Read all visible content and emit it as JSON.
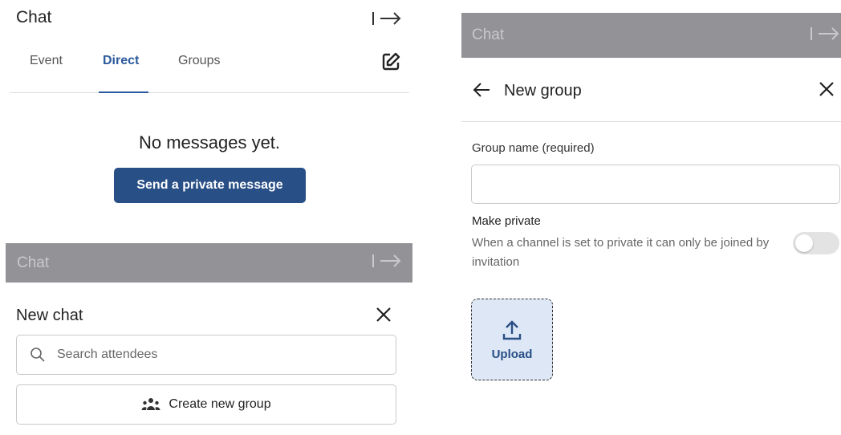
{
  "panel1": {
    "title": "Chat",
    "tabs": [
      {
        "label": "Event"
      },
      {
        "label": "Direct"
      },
      {
        "label": "Groups"
      }
    ],
    "active_tab": "Direct",
    "empty_text": "No messages yet.",
    "send_button": "Send a private message",
    "icons": {
      "collapse": "collapse-right-arrow-icon",
      "compose": "compose-edit-icon"
    }
  },
  "panel2": {
    "overlay_title": "Chat",
    "title": "New chat",
    "search_placeholder": "Search attendees",
    "create_group": "Create new group",
    "icons": {
      "close": "close-icon",
      "search": "search-icon",
      "group": "group-icon"
    }
  },
  "panel3": {
    "overlay_title": "Chat",
    "title": "New group",
    "group_name_label": "Group name (required)",
    "group_name_value": "",
    "make_private_label": "Make private",
    "make_private_desc": "When a channel is set to private it can only be joined by invitation",
    "make_private_on": false,
    "upload_label": "Upload",
    "icons": {
      "back": "arrow-left-icon",
      "close": "close-icon",
      "upload": "upload-icon"
    }
  },
  "colors": {
    "accent": "#284f86",
    "tab_active": "#2b5a9c",
    "overlay": "#939297",
    "upload_bg": "#dde7f5"
  }
}
